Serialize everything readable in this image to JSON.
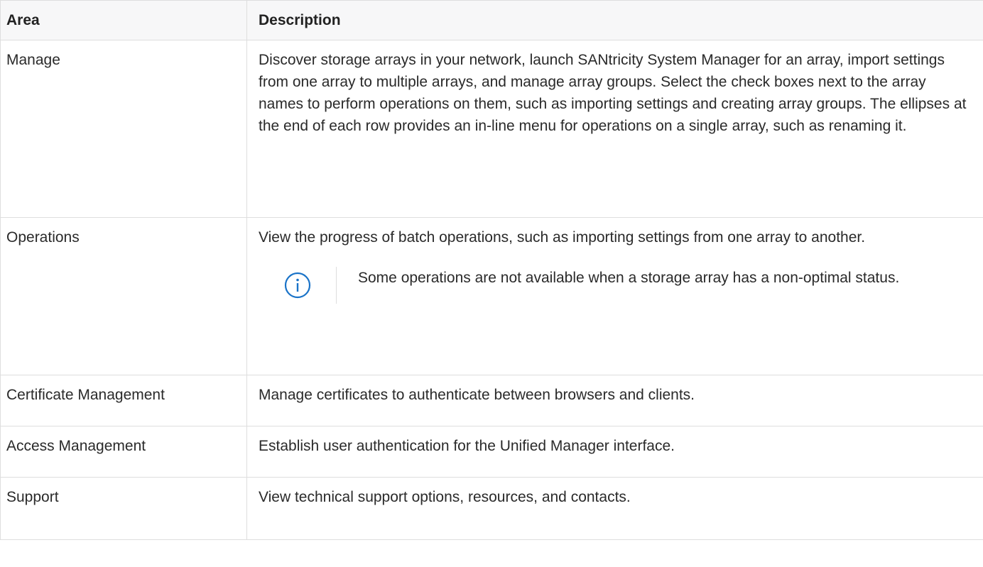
{
  "table": {
    "headers": {
      "area": "Area",
      "description": "Description"
    },
    "rows": [
      {
        "area": "Manage",
        "description": "Discover storage arrays in your network, launch SANtricity System Manager for an array, import settings from one array to multiple arrays, and manage array groups. Select the check boxes next to the array names to perform operations on them, such as importing settings and creating array groups. The ellipses at the end of each row provides an in-line menu for operations on a single array, such as renaming it."
      },
      {
        "area": "Operations",
        "description": "View the progress of batch operations, such as importing settings from one array to another.",
        "note": {
          "icon": "info-icon",
          "text": "Some operations are not available when a storage array has a non-optimal status."
        }
      },
      {
        "area": "Certificate Management",
        "description": "Manage certificates to authenticate between browsers and clients."
      },
      {
        "area": "Access Management",
        "description": "Establish user authentication for the Unified Manager interface."
      },
      {
        "area": "Support",
        "description": "View technical support options, resources, and contacts."
      }
    ]
  },
  "colors": {
    "border": "#dedede",
    "header_background": "#f7f7f8",
    "info_icon": "#1a73c8",
    "text": "#2a2a2a"
  }
}
